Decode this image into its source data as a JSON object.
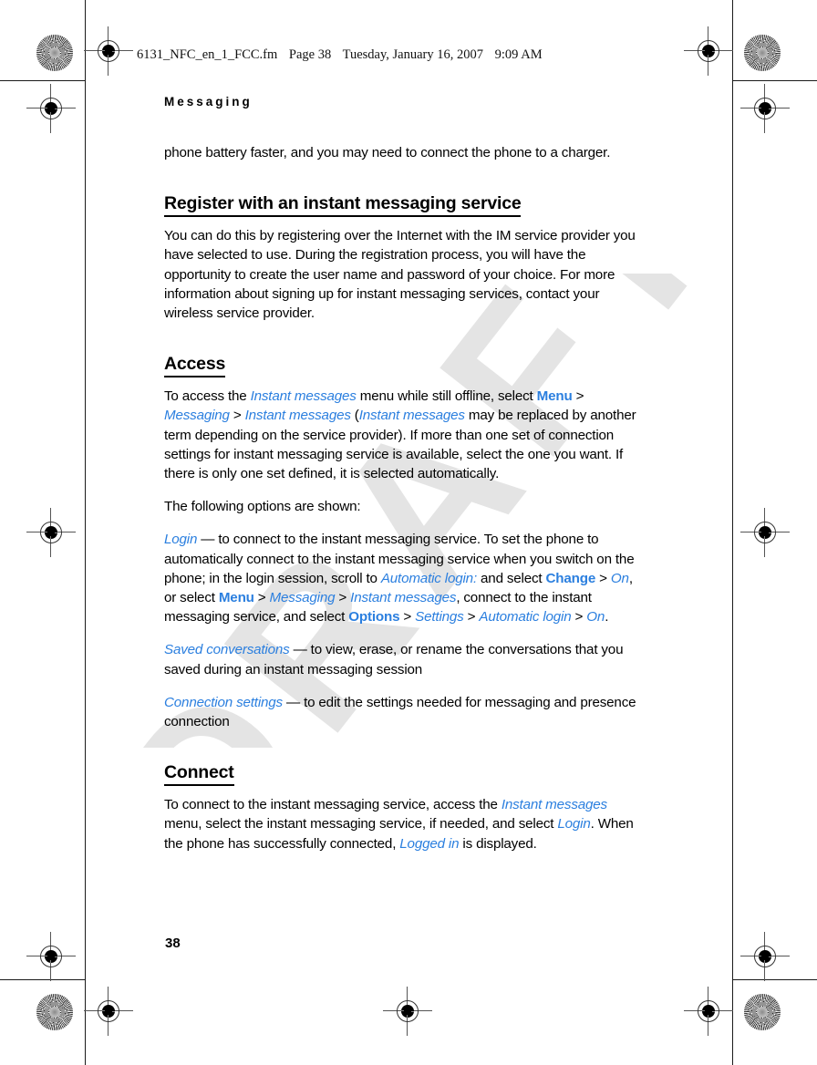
{
  "prepress": {
    "filmstrip": {
      "filename": "6131_NFC_en_1_FCC.fm",
      "page_label": "Page 38",
      "date": "Tuesday, January 16, 2007",
      "time": "9:09 AM"
    },
    "marks": {
      "registration_name": "registration-target",
      "rosette_name": "star-density-target"
    }
  },
  "watermark": {
    "text": "DRAFT",
    "color": "#e4e4e4"
  },
  "colors": {
    "ui_blue": "#2b7fdf",
    "text_black": "#000000"
  },
  "page": {
    "running_head": "Messaging",
    "page_number": "38"
  },
  "content": {
    "intro_paragraph": "phone battery faster, and you may need to connect the phone to a charger.",
    "sections": [
      {
        "id": "register",
        "heading": "Register with an instant messaging service",
        "paragraph": "You can do this by registering over the Internet with the IM service provider you have selected to use. During the registration process, you will have the opportunity to create the user name and password of your choice. For more information about signing up for instant messaging services, contact your wireless service provider."
      },
      {
        "id": "access",
        "heading": "Access"
      },
      {
        "id": "connect",
        "heading": "Connect"
      }
    ],
    "access": {
      "intro": {
        "t1": "To access the ",
        "p1": "Instant messages",
        "t2": " menu while still offline, select ",
        "c1": "Menu",
        "s1": " > ",
        "p2": "Messaging",
        "s2": " > ",
        "p3": "Instant messages",
        "t3": " (",
        "p4": "Instant messages",
        "t4": " may be replaced by another term depending on the service provider). If more than one set of connection settings for instant messaging service is available, select the one you want. If there is only one set defined, it is selected automatically."
      },
      "options_lead": "The following options are shown:",
      "options": [
        {
          "name": "login",
          "p1": "Login",
          "t1": " — to connect to the instant messaging service. To set the phone to automatically connect to the instant messaging service when you switch on the phone; in the login session, scroll to ",
          "p2": "Automatic login:",
          "t2": " and select ",
          "c1": "Change",
          "s1": " > ",
          "p3": "On",
          "t3": ", or select ",
          "c2": "Menu",
          "s2": " > ",
          "p4": "Messaging",
          "s3": " > ",
          "p5": "Instant messages",
          "t4": ", connect to the instant messaging service, and select ",
          "c3": "Options",
          "s4": " > ",
          "p6": "Settings",
          "s5": " > ",
          "p7": "Automatic login",
          "s6": " > ",
          "p8": "On",
          "t5": "."
        },
        {
          "name": "saved-conversations",
          "p1": "Saved conversations",
          "t1": " — to view, erase, or rename the conversations that you saved during an instant messaging session"
        },
        {
          "name": "connection-settings",
          "p1": "Connection settings",
          "t1": " — to edit the settings needed for messaging and presence connection"
        }
      ]
    },
    "connect": {
      "t1": "To connect to the instant messaging service, access the ",
      "p1": "Instant messages",
      "t2": " menu, select the instant messaging service, if needed, and select ",
      "p2": "Login",
      "t3": ". When the phone has successfully connected, ",
      "p3": "Logged in",
      "t4": " is displayed."
    }
  }
}
